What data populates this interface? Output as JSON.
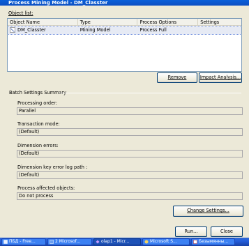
{
  "window": {
    "title": "Process Mining Model - DM_Classter"
  },
  "object_list": {
    "label": "Object list:",
    "columns": [
      "Object Name",
      "Type",
      "Process Options",
      "Settings"
    ],
    "rows": [
      {
        "name": "DM_Classter",
        "type": "Mining Model",
        "process_options": "Process Full",
        "settings": ""
      }
    ]
  },
  "buttons": {
    "remove": "Remove",
    "impact_analysis": "Impact Analysis...",
    "change_settings": "Change Settings...",
    "run": "Run...",
    "close": "Close"
  },
  "batch_settings": {
    "title": "Batch Settings Summary",
    "fields": [
      {
        "label": "Processing order:",
        "value": "Parallel"
      },
      {
        "label": "Transaction mode:",
        "value": "(Default)"
      },
      {
        "label": "Dimension errors:",
        "value": "(Default)"
      },
      {
        "label": "Dimension key error log path :",
        "value": "(Default)"
      },
      {
        "label": "Process affected objects:",
        "value": "Do not process"
      }
    ]
  },
  "taskbar": {
    "items": [
      {
        "label": "ПБД - Free...",
        "icon": "app-icon"
      },
      {
        "label": "2 Microsof...",
        "icon": "windows-group-icon"
      },
      {
        "label": "olap1 - Micr...",
        "icon": "visual-studio-icon",
        "active": true
      },
      {
        "label": "Microsoft S...",
        "icon": "sql-server-icon"
      },
      {
        "label": "Безымянны...",
        "icon": "paint-icon"
      }
    ]
  },
  "colors": {
    "title_bar": "#0c55cf",
    "dialog_bg": "#ece9d8",
    "taskbar": "#245edb",
    "selection": "#e6eaf4"
  }
}
